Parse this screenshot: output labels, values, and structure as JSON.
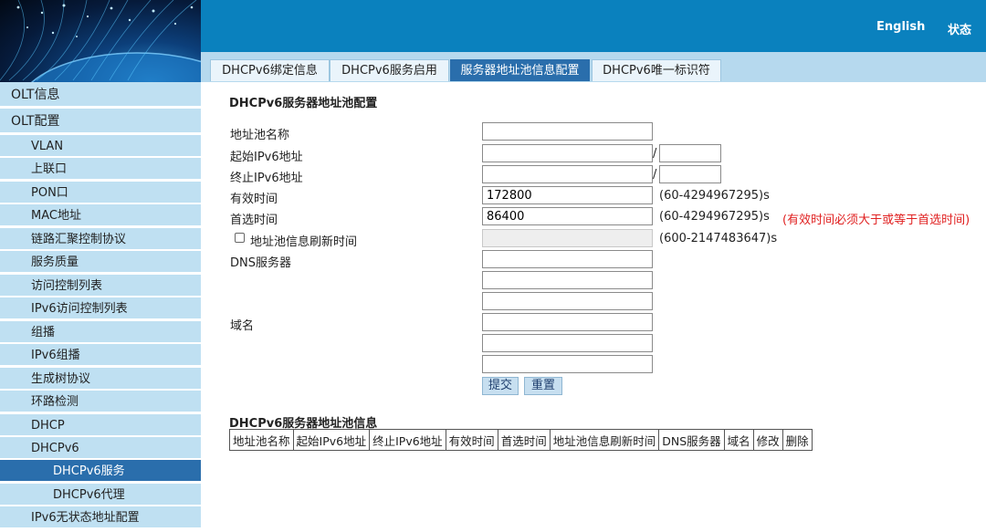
{
  "header": {
    "language_link": "English",
    "status_link": "状态"
  },
  "tabs": [
    {
      "label": "DHCPv6绑定信息"
    },
    {
      "label": "DHCPv6服务启用"
    },
    {
      "label": "服务器地址池信息配置",
      "active": true
    },
    {
      "label": "DHCPv6唯一标识符"
    }
  ],
  "sidebar": {
    "items": [
      {
        "label": "OLT信息"
      },
      {
        "label": "OLT配置"
      },
      {
        "label": "VLAN"
      },
      {
        "label": "上联口"
      },
      {
        "label": "PON口"
      },
      {
        "label": "MAC地址"
      },
      {
        "label": "链路汇聚控制协议"
      },
      {
        "label": "服务质量"
      },
      {
        "label": "访问控制列表"
      },
      {
        "label": "IPv6访问控制列表"
      },
      {
        "label": "组播"
      },
      {
        "label": "IPv6组播"
      },
      {
        "label": "生成树协议"
      },
      {
        "label": "环路检测"
      },
      {
        "label": "DHCP"
      },
      {
        "label": "DHCPv6"
      },
      {
        "label": "DHCPv6服务",
        "active": true
      },
      {
        "label": "DHCPv6代理"
      },
      {
        "label": "IPv6无状态地址配置"
      }
    ]
  },
  "form": {
    "section_title": "DHCPv6服务器地址池配置",
    "pool_name_label": "地址池名称",
    "pool_name_value": "",
    "start_ip_label": "起始IPv6地址",
    "start_ip_value": "",
    "start_prefix_value": "",
    "end_ip_label": "终止IPv6地址",
    "end_ip_value": "",
    "end_prefix_value": "",
    "slash": "/",
    "valid_time_label": "有效时间",
    "valid_time_value": "172800",
    "valid_time_hint": "(60-4294967295)s",
    "preferred_time_label": "首选时间",
    "preferred_time_value": "86400",
    "preferred_time_hint": "(60-4294967295)s",
    "preferred_time_warning": "(有效时间必须大于或等于首选时间)",
    "refresh_label": "地址池信息刷新时间",
    "refresh_checked": false,
    "refresh_value": "",
    "refresh_hint": "(600-2147483647)s",
    "dns_label": "DNS服务器",
    "dns_values": [
      "",
      "",
      ""
    ],
    "domain_label": "域名",
    "domain_values": [
      "",
      "",
      ""
    ],
    "submit_label": "提交",
    "reset_label": "重置"
  },
  "pool_table": {
    "title": "DHCPv6服务器地址池信息",
    "columns": [
      "地址池名称",
      "起始IPv6地址",
      "终止IPv6地址",
      "有效时间",
      "首选时间",
      "地址池信息刷新时间",
      "DNS服务器",
      "域名",
      "修改",
      "删除"
    ]
  },
  "colors": {
    "topbar": "#0a81be",
    "tabbar": "#b6d9ee",
    "sidebar_item": "#bfe0f2",
    "active": "#2a6eac",
    "warning": "#e02020"
  }
}
